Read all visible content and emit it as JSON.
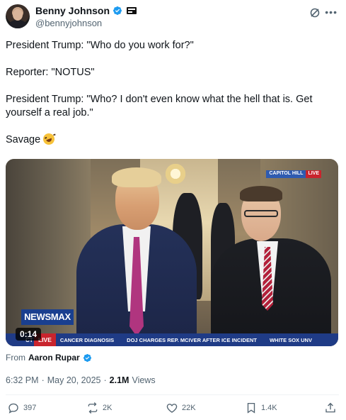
{
  "author": {
    "name": "Benny Johnson",
    "handle": "@bennyjohnson"
  },
  "tweet": {
    "lines": [
      "President Trump: \"Who do you work for?\"",
      "Reporter: \"NOTUS\"",
      "President Trump: \"Who? I don't even know what the hell that is. Get yourself a real job.\"",
      "Savage"
    ]
  },
  "video": {
    "duration": "0:14",
    "network_logo": "NEWSMAX",
    "location_bug": "CAPITOL HILL",
    "location_live": "LIVE",
    "ticker_live": "LIVE",
    "ticker_prefix": "CT",
    "ticker_items": [
      "CANCER DIAGNOSIS",
      "DOJ CHARGES REP. MCIVER AFTER ICE INCIDENT",
      "WHITE SOX UNV"
    ]
  },
  "attribution": {
    "prefix": "From",
    "name": "Aaron Rupar"
  },
  "meta": {
    "time": "6:32 PM",
    "separator": "·",
    "date": "May 20, 2025",
    "views_count": "2.1M",
    "views_label": "Views"
  },
  "actions": {
    "replies": "397",
    "reposts": "2K",
    "likes": "22K",
    "bookmarks": "1.4K"
  },
  "colors": {
    "verified_blue": "#1d9bf0",
    "text_secondary": "#536471",
    "newsmax_blue": "#1a3f8f",
    "live_red": "#c9242d"
  }
}
